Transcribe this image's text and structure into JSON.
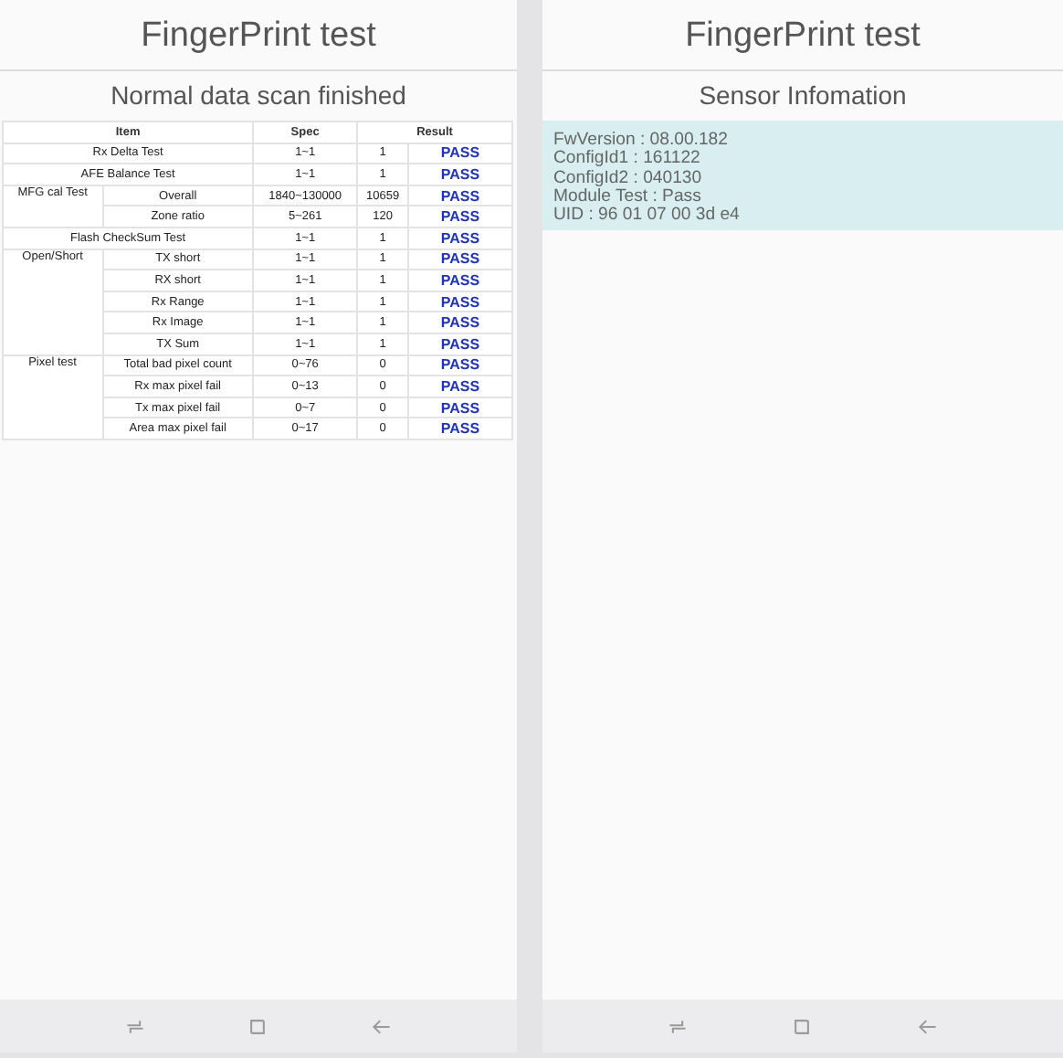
{
  "screens": [
    {
      "kind": "table",
      "title": "FingerPrint test",
      "subtitle": "Normal data scan finished",
      "table": {
        "columns": [
          "Item",
          "Spec",
          "Result"
        ],
        "rows": [
          {
            "kind": "single",
            "name": "Rx Delta Test",
            "spec": "1~1",
            "value": "1",
            "status": "PASS"
          },
          {
            "kind": "single",
            "name": "AFE Balance Test",
            "spec": "1~1",
            "value": "1",
            "status": "PASS"
          },
          {
            "kind": "group",
            "name": "MFG cal Test",
            "items": [
              {
                "name": "Overall",
                "spec": "1840~130000",
                "value": "10659",
                "status": "PASS"
              },
              {
                "name": "Zone ratio",
                "spec": "5~261",
                "value": "120",
                "status": "PASS"
              }
            ]
          },
          {
            "kind": "single",
            "name": "Flash CheckSum Test",
            "spec": "1~1",
            "value": "1",
            "status": "PASS"
          },
          {
            "kind": "group",
            "name": "Open/Short",
            "items": [
              {
                "name": "TX short",
                "spec": "1~1",
                "value": "1",
                "status": "PASS"
              },
              {
                "name": "RX short",
                "spec": "1~1",
                "value": "1",
                "status": "PASS"
              },
              {
                "name": "Rx Range",
                "spec": "1~1",
                "value": "1",
                "status": "PASS"
              },
              {
                "name": "Rx Image",
                "spec": "1~1",
                "value": "1",
                "status": "PASS"
              },
              {
                "name": "TX Sum",
                "spec": "1~1",
                "value": "1",
                "status": "PASS"
              }
            ]
          },
          {
            "kind": "group",
            "name": "Pixel test",
            "items": [
              {
                "name": "Total bad pixel count",
                "spec": "0~76",
                "value": "0",
                "status": "PASS"
              },
              {
                "name": "Rx max pixel fail",
                "spec": "0~13",
                "value": "0",
                "status": "PASS"
              },
              {
                "name": "Tx max pixel fail",
                "spec": "0~7",
                "value": "0",
                "status": "PASS"
              },
              {
                "name": "Area max pixel fail",
                "spec": "0~17",
                "value": "0",
                "status": "PASS"
              }
            ]
          }
        ]
      }
    },
    {
      "kind": "info",
      "title": "FingerPrint test",
      "subtitle": "Sensor Infomation",
      "lines": [
        "FwVersion : 08.00.182",
        "ConfigId1 : 161122",
        "ConfigId2 : 040130",
        "Module Test : Pass",
        "UID : 96 01 07 00 3d e4"
      ]
    }
  ]
}
